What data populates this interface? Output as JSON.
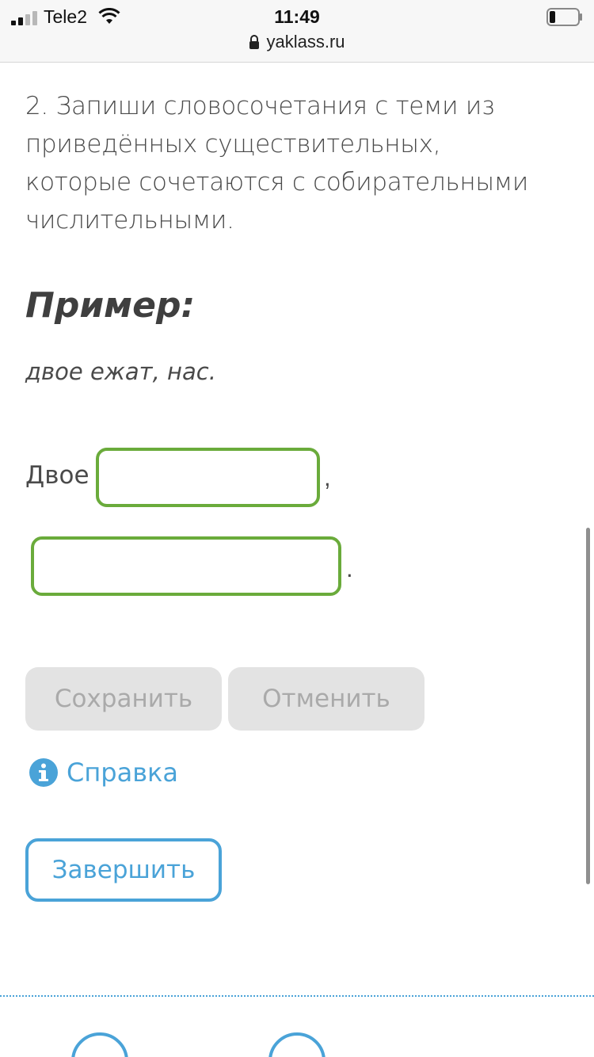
{
  "status_bar": {
    "carrier": "Tele2",
    "time": "11:49"
  },
  "browser": {
    "url": "yaklass.ru"
  },
  "task": {
    "text": "2. Запиши словосочетания с теми из приведённых существительных, которые сочетаются с собирательными числительными."
  },
  "example": {
    "title": "Пример:",
    "text": "двое ежат, нас."
  },
  "exercise": {
    "label": "Двое",
    "comma": ",",
    "period": ".",
    "input1_value": "",
    "input2_value": ""
  },
  "buttons": {
    "save": "Сохранить",
    "cancel": "Отменить",
    "help": "Справка",
    "finish": "Завершить"
  },
  "colors": {
    "input_border": "#6aab3b",
    "accent_blue": "#4aa3d8",
    "disabled_bg": "#e3e3e3"
  }
}
